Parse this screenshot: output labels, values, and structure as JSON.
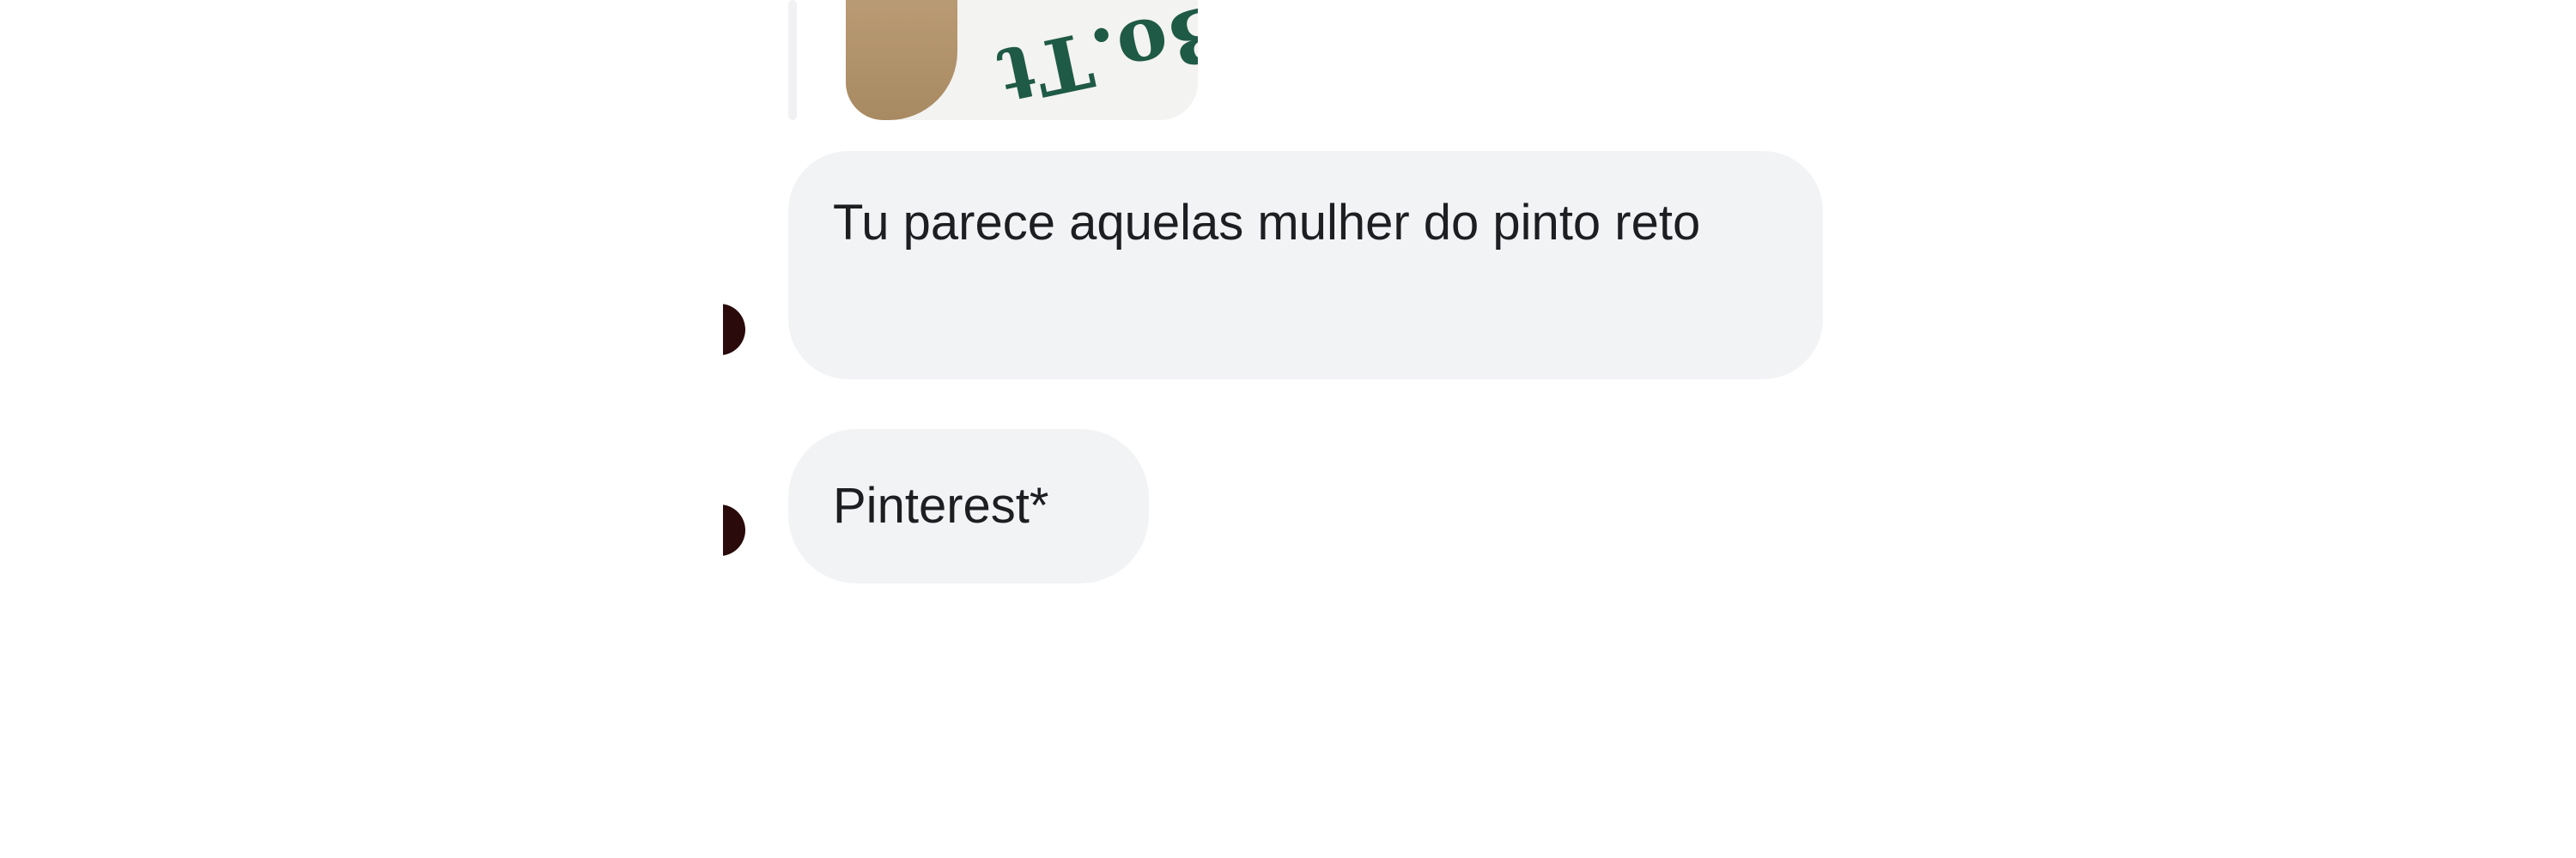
{
  "conversation": {
    "shared_photo": {
      "print_text": "Bo.Tt"
    },
    "messages": [
      {
        "sender": "other",
        "text": "Tu parece aquelas mulher do pinto reto"
      },
      {
        "sender": "other",
        "text": "Pinterest*"
      }
    ]
  },
  "colors": {
    "bubble_bg": "#f2f3f5",
    "text": "#1c1e21",
    "avatar": "#2a0a0a"
  }
}
